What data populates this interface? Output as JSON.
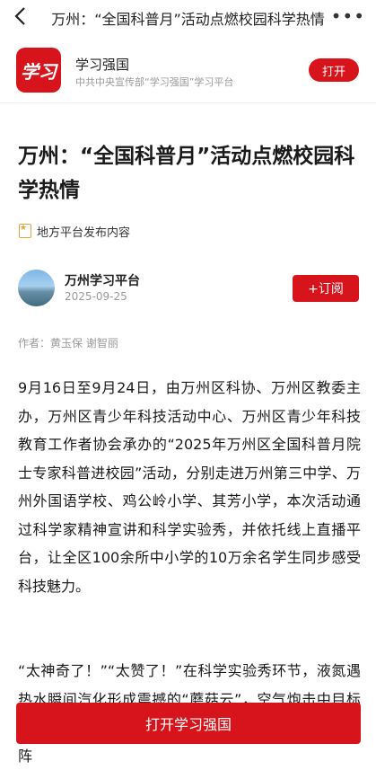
{
  "header": {
    "title": "万州：“全国科普月”活动点燃校园科学热情"
  },
  "app_banner": {
    "logo_text": "学习",
    "name": "学习强国",
    "subtitle": "中共中央宣传部“学习强国”学习平台",
    "open_label": "打开"
  },
  "article": {
    "headline": "万州：“全国科普月”活动点燃校园科学热情",
    "source_badge": "地方平台发布内容",
    "author_name": "万州学习平台",
    "publish_date": "2025-09-25",
    "subscribe_label": "+订阅",
    "byline": "作者：黄玉保 谢智丽",
    "paragraphs": [
      "9月16日至9月24日，由万州区科协、万州区教委主办，万州区青少年科技活动中心、万州区青少年科技教育工作者协会承办的“2025年万州区全国科普月院士专家科普进校园”活动，分别走进万州第三中学、万州外国语学校、鸡公岭小学、其芳小学，本次活动通过科学家精神宣讲和科学实验秀，并依托线上直播平台，让全区100余所中小学的10万余名学生同步感受科技魅力。",
      "“太神奇了！”“太赞了！”在科学实验秀环节，液氮遇热水瞬间汽化形成震撼的“蘑菇云”，空气炮击中目标时的……学变色反应犹如魔术般瞬间切换色彩，赢得阵"
    ]
  },
  "bottom_cta": {
    "label": "打开学习强国"
  },
  "colors": {
    "brand_red": "#d7141c"
  }
}
